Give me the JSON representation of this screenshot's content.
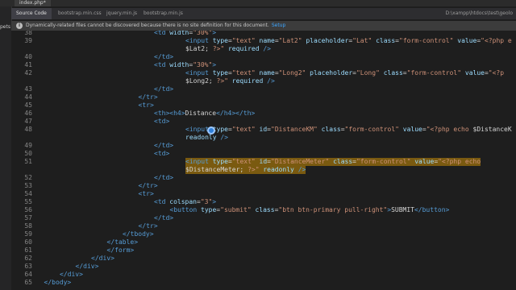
{
  "window": {
    "file_tab": "index.php*",
    "path": "D:\\xampp\\htdocs\\test\\geolo"
  },
  "tabs": [
    "Source Code",
    "bootstrap.min.css",
    "jquery.min.js",
    "bootstrap.min.js"
  ],
  "notification": {
    "text": "Dynamically-related files cannot be discovered because there is no site definition for this document.",
    "link": "Setup"
  },
  "side_panel": {
    "label": "pets"
  },
  "code_lines": [
    {
      "n": "38",
      "indent": 6,
      "tokens": [
        [
          "tag",
          "<td "
        ],
        [
          "attr",
          "width"
        ],
        [
          "txt",
          "="
        ],
        [
          "str",
          "\"30%\""
        ],
        [
          "tag",
          ">"
        ]
      ]
    },
    {
      "n": "39",
      "indent": 8,
      "tokens": [
        [
          "tag",
          "<input "
        ],
        [
          "attr",
          "type"
        ],
        [
          "txt",
          "="
        ],
        [
          "str",
          "\"text\""
        ],
        [
          "attr",
          " name"
        ],
        [
          "txt",
          "="
        ],
        [
          "str",
          "\"Lat2\""
        ],
        [
          "attr",
          " placeholder"
        ],
        [
          "txt",
          "="
        ],
        [
          "str",
          "\"Lat\""
        ],
        [
          "attr",
          " class"
        ],
        [
          "txt",
          "="
        ],
        [
          "str",
          "\"form-control\""
        ],
        [
          "attr",
          " value"
        ],
        [
          "txt",
          "="
        ],
        [
          "str",
          "\"<?php e"
        ]
      ]
    },
    {
      "n": "",
      "indent": 8,
      "tokens": [
        [
          "txt",
          "$Lat2; "
        ],
        [
          "str",
          "?>\""
        ],
        [
          "attr",
          " required "
        ],
        [
          "tag",
          "/>"
        ]
      ]
    },
    {
      "n": "40",
      "indent": 6,
      "tokens": [
        [
          "tag",
          "</td>"
        ]
      ]
    },
    {
      "n": "41",
      "indent": 6,
      "tokens": [
        [
          "tag",
          "<td "
        ],
        [
          "attr",
          "width"
        ],
        [
          "txt",
          "="
        ],
        [
          "str",
          "\"30%\""
        ],
        [
          "tag",
          ">"
        ]
      ]
    },
    {
      "n": "42",
      "indent": 8,
      "tokens": [
        [
          "tag",
          "<input "
        ],
        [
          "attr",
          "type"
        ],
        [
          "txt",
          "="
        ],
        [
          "str",
          "\"text\""
        ],
        [
          "attr",
          " name"
        ],
        [
          "txt",
          "="
        ],
        [
          "str",
          "\"Long2\""
        ],
        [
          "attr",
          " placeholder"
        ],
        [
          "txt",
          "="
        ],
        [
          "str",
          "\"Long\""
        ],
        [
          "attr",
          " class"
        ],
        [
          "txt",
          "="
        ],
        [
          "str",
          "\"form-control\""
        ],
        [
          "attr",
          " value"
        ],
        [
          "txt",
          "="
        ],
        [
          "str",
          "\"<?p"
        ]
      ]
    },
    {
      "n": "",
      "indent": 8,
      "tokens": [
        [
          "txt",
          "$Long2; "
        ],
        [
          "str",
          "?>\""
        ],
        [
          "attr",
          " required "
        ],
        [
          "tag",
          "/>"
        ]
      ]
    },
    {
      "n": "43",
      "indent": 6,
      "tokens": [
        [
          "tag",
          "</td>"
        ]
      ]
    },
    {
      "n": "44",
      "indent": 5,
      "tokens": [
        [
          "tag",
          "</tr>"
        ]
      ]
    },
    {
      "n": "45",
      "indent": 5,
      "tokens": [
        [
          "tag",
          "<tr>"
        ]
      ]
    },
    {
      "n": "46",
      "indent": 6,
      "tokens": [
        [
          "tag",
          "<th><h4>"
        ],
        [
          "txt",
          "Distance"
        ],
        [
          "tag",
          "</h4></th>"
        ]
      ]
    },
    {
      "n": "47",
      "indent": 6,
      "tokens": [
        [
          "tag",
          "<td>"
        ]
      ]
    },
    {
      "n": "48",
      "indent": 8,
      "tokens": [
        [
          "tag",
          "<input "
        ],
        [
          "attr",
          "type"
        ],
        [
          "txt",
          "="
        ],
        [
          "str",
          "\"text\""
        ],
        [
          "attr",
          " id"
        ],
        [
          "txt",
          "="
        ],
        [
          "str",
          "\"DistanceKM\""
        ],
        [
          "attr",
          " class"
        ],
        [
          "txt",
          "="
        ],
        [
          "str",
          "\"form-control\""
        ],
        [
          "attr",
          " value"
        ],
        [
          "txt",
          "="
        ],
        [
          "str",
          "\"<?php echo "
        ],
        [
          "txt",
          "$DistanceK"
        ]
      ]
    },
    {
      "n": "",
      "indent": 8,
      "tokens": [
        [
          "attr",
          "readonly "
        ],
        [
          "tag",
          "/>"
        ]
      ]
    },
    {
      "n": "49",
      "indent": 6,
      "tokens": [
        [
          "tag",
          "</td>"
        ]
      ]
    },
    {
      "n": "50",
      "indent": 6,
      "tokens": [
        [
          "tag",
          "<td>"
        ]
      ]
    },
    {
      "n": "51",
      "indent": 8,
      "hl": true,
      "tokens": [
        [
          "tag",
          "<input "
        ],
        [
          "attr",
          "type"
        ],
        [
          "txt",
          "="
        ],
        [
          "str",
          "\"text\""
        ],
        [
          "attr",
          " id"
        ],
        [
          "txt",
          "="
        ],
        [
          "str",
          "\"DistanceMeter\""
        ],
        [
          "attr",
          " class"
        ],
        [
          "txt",
          "="
        ],
        [
          "str",
          "\"form-control\""
        ],
        [
          "attr",
          " value"
        ],
        [
          "txt",
          "="
        ],
        [
          "str",
          "\"<?php echo"
        ]
      ]
    },
    {
      "n": "",
      "indent": 8,
      "hl": true,
      "tokens": [
        [
          "txt",
          "$DistanceMeter; "
        ],
        [
          "str",
          "?>\""
        ],
        [
          "attr",
          " readonly "
        ],
        [
          "tag",
          "/>"
        ]
      ]
    },
    {
      "n": "52",
      "indent": 6,
      "tokens": [
        [
          "tag",
          "</td>"
        ]
      ]
    },
    {
      "n": "53",
      "indent": 5,
      "tokens": [
        [
          "tag",
          "</tr>"
        ]
      ]
    },
    {
      "n": "54",
      "indent": 5,
      "tokens": [
        [
          "tag",
          "<tr>"
        ]
      ]
    },
    {
      "n": "55",
      "indent": 6,
      "tokens": [
        [
          "tag",
          "<td "
        ],
        [
          "attr",
          "colspan"
        ],
        [
          "txt",
          "="
        ],
        [
          "str",
          "\"3\""
        ],
        [
          "tag",
          ">"
        ]
      ]
    },
    {
      "n": "56",
      "indent": 7,
      "tokens": [
        [
          "tag",
          "<button "
        ],
        [
          "attr",
          "type"
        ],
        [
          "txt",
          "="
        ],
        [
          "str",
          "\"submit\""
        ],
        [
          "attr",
          " class"
        ],
        [
          "txt",
          "="
        ],
        [
          "str",
          "\"btn btn-primary pull-right\""
        ],
        [
          "tag",
          ">"
        ],
        [
          "txt",
          "SUBMIT"
        ],
        [
          "tag",
          "</button>"
        ]
      ]
    },
    {
      "n": "57",
      "indent": 6,
      "tokens": [
        [
          "tag",
          "</td>"
        ]
      ]
    },
    {
      "n": "58",
      "indent": 5,
      "tokens": [
        [
          "tag",
          "</tr>"
        ]
      ]
    },
    {
      "n": "59",
      "indent": 4,
      "tokens": [
        [
          "tag",
          "</tbody>"
        ]
      ]
    },
    {
      "n": "60",
      "indent": 3,
      "tokens": [
        [
          "tag",
          "</table>"
        ]
      ]
    },
    {
      "n": "61",
      "indent": 3,
      "tokens": [
        [
          "tag",
          "</form>"
        ]
      ]
    },
    {
      "n": "62",
      "indent": 2,
      "tokens": [
        [
          "tag",
          "</div>"
        ]
      ]
    },
    {
      "n": "63",
      "indent": 1,
      "tokens": [
        [
          "tag",
          "</div>"
        ]
      ]
    },
    {
      "n": "64",
      "indent": 0,
      "tokens": [
        [
          "tag",
          "</div>"
        ]
      ]
    },
    {
      "n": "65",
      "indent": -1,
      "tokens": [
        [
          "tag",
          "</body>"
        ]
      ]
    }
  ]
}
